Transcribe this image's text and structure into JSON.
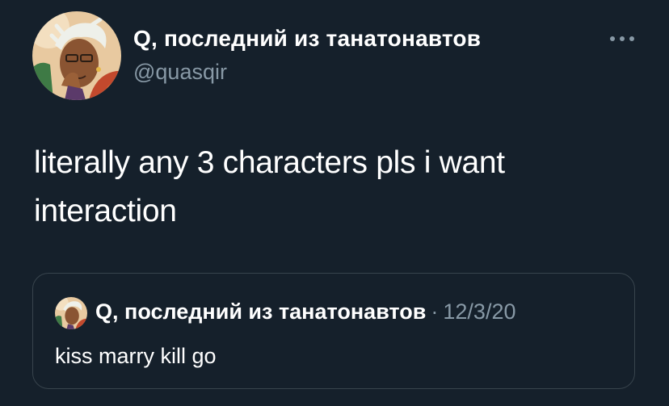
{
  "tweet": {
    "author": {
      "display_name": "Q, последний из танатонавтов",
      "handle": "@quasqir",
      "avatar_icon": "profile-illustration-avatar"
    },
    "more_icon": "more-options-icon",
    "text": "literally any 3 characters pls i want interaction",
    "quoted_tweet": {
      "author": {
        "display_name": "Q, последний из танатонавтов",
        "avatar_icon": "profile-illustration-avatar"
      },
      "separator": "·",
      "date": "12/3/20",
      "text": "kiss marry kill go"
    }
  },
  "colors": {
    "background": "#15202b",
    "text_primary": "#ffffff",
    "text_secondary": "#8899a6",
    "card_border": "#38444d"
  }
}
